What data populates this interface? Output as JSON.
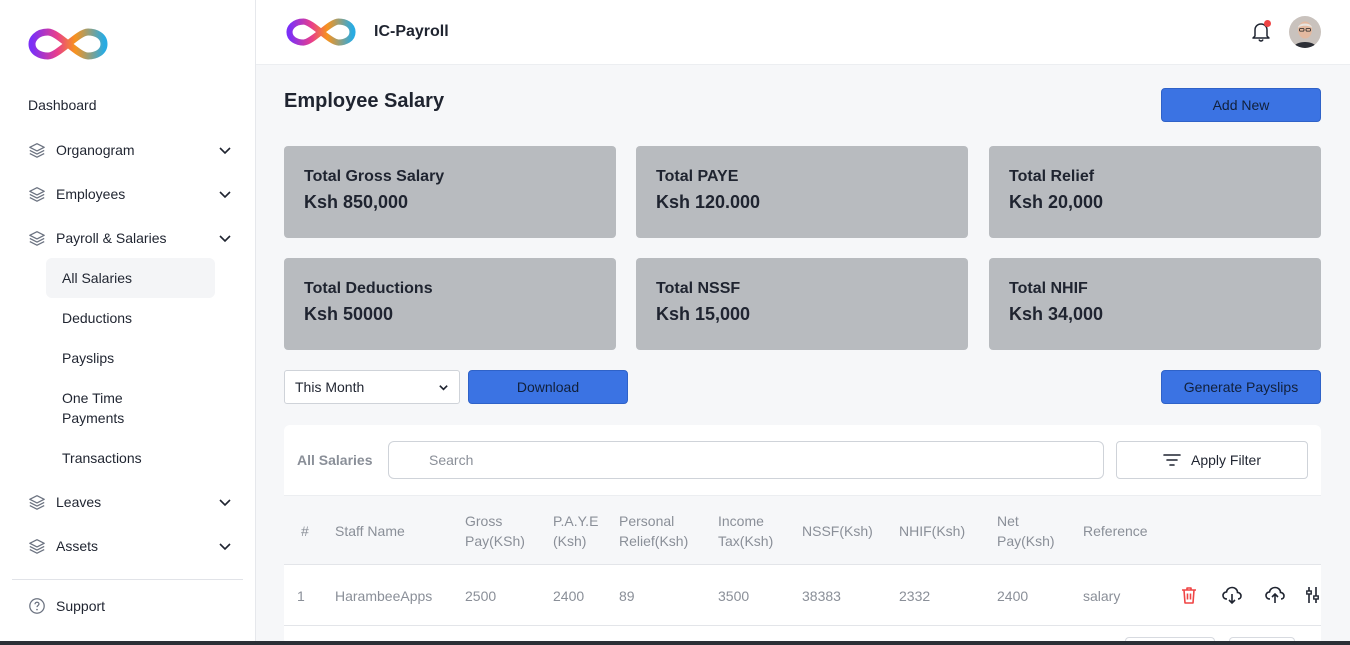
{
  "app": {
    "title": "IC-Payroll"
  },
  "colors": {
    "primary": "#3b73e3",
    "card_bg": "#b8bbbf",
    "danger": "#ef4444"
  },
  "sidebar": {
    "dashboard": "Dashboard",
    "groups": [
      {
        "label": "Organogram",
        "icon": "layers-icon"
      },
      {
        "label": "Employees",
        "icon": "layers-icon"
      },
      {
        "label": "Payroll & Salaries",
        "icon": "layers-icon"
      },
      {
        "label": "Leaves",
        "icon": "layers-icon"
      },
      {
        "label": "Assets",
        "icon": "layers-icon"
      }
    ],
    "payroll_items": [
      "All Salaries",
      "Deductions",
      "Payslips",
      "One Time Payments",
      "Transactions"
    ],
    "active_item": "All Salaries",
    "support": "Support"
  },
  "main": {
    "title": "Employee Salary",
    "add_new": "Add New",
    "cards": [
      {
        "label": "Total Gross Salary",
        "value": "Ksh 850,000"
      },
      {
        "label": "Total PAYE",
        "value": "Ksh 120.000"
      },
      {
        "label": "Total Relief",
        "value": "Ksh 20,000"
      },
      {
        "label": "Total Deductions",
        "value": "Ksh 50000"
      },
      {
        "label": "Total NSSF",
        "value": "Ksh 15,000"
      },
      {
        "label": "Total NHIF",
        "value": "Ksh 34,000"
      }
    ],
    "period_select": "This Month",
    "download": "Download",
    "generate_payslips": "Generate Payslips"
  },
  "table": {
    "title": "All Salaries",
    "search_placeholder": "Search",
    "apply_filter": "Apply Filter",
    "headers": [
      "#",
      "Staff Name",
      "Gross Pay(KSh)",
      "P.A.Y.E (Ksh)",
      "Personal Relief(Ksh)",
      "Income Tax(Ksh)",
      "NSSF(Ksh)",
      "NHIF(Ksh)",
      "Net Pay(Ksh)",
      "Reference"
    ],
    "rows": [
      {
        "no": "1",
        "staff_name": "HarambeeApps",
        "gross_pay": "2500",
        "paye": "2400",
        "personal_relief": "89",
        "income_tax": "3500",
        "nssf": "38383",
        "nhif": "2332",
        "net_pay": "2400",
        "reference": "salary"
      }
    ],
    "row_actions": [
      "trash-icon",
      "download-cloud-icon",
      "upload-cloud-icon",
      "adjust-icon"
    ]
  }
}
